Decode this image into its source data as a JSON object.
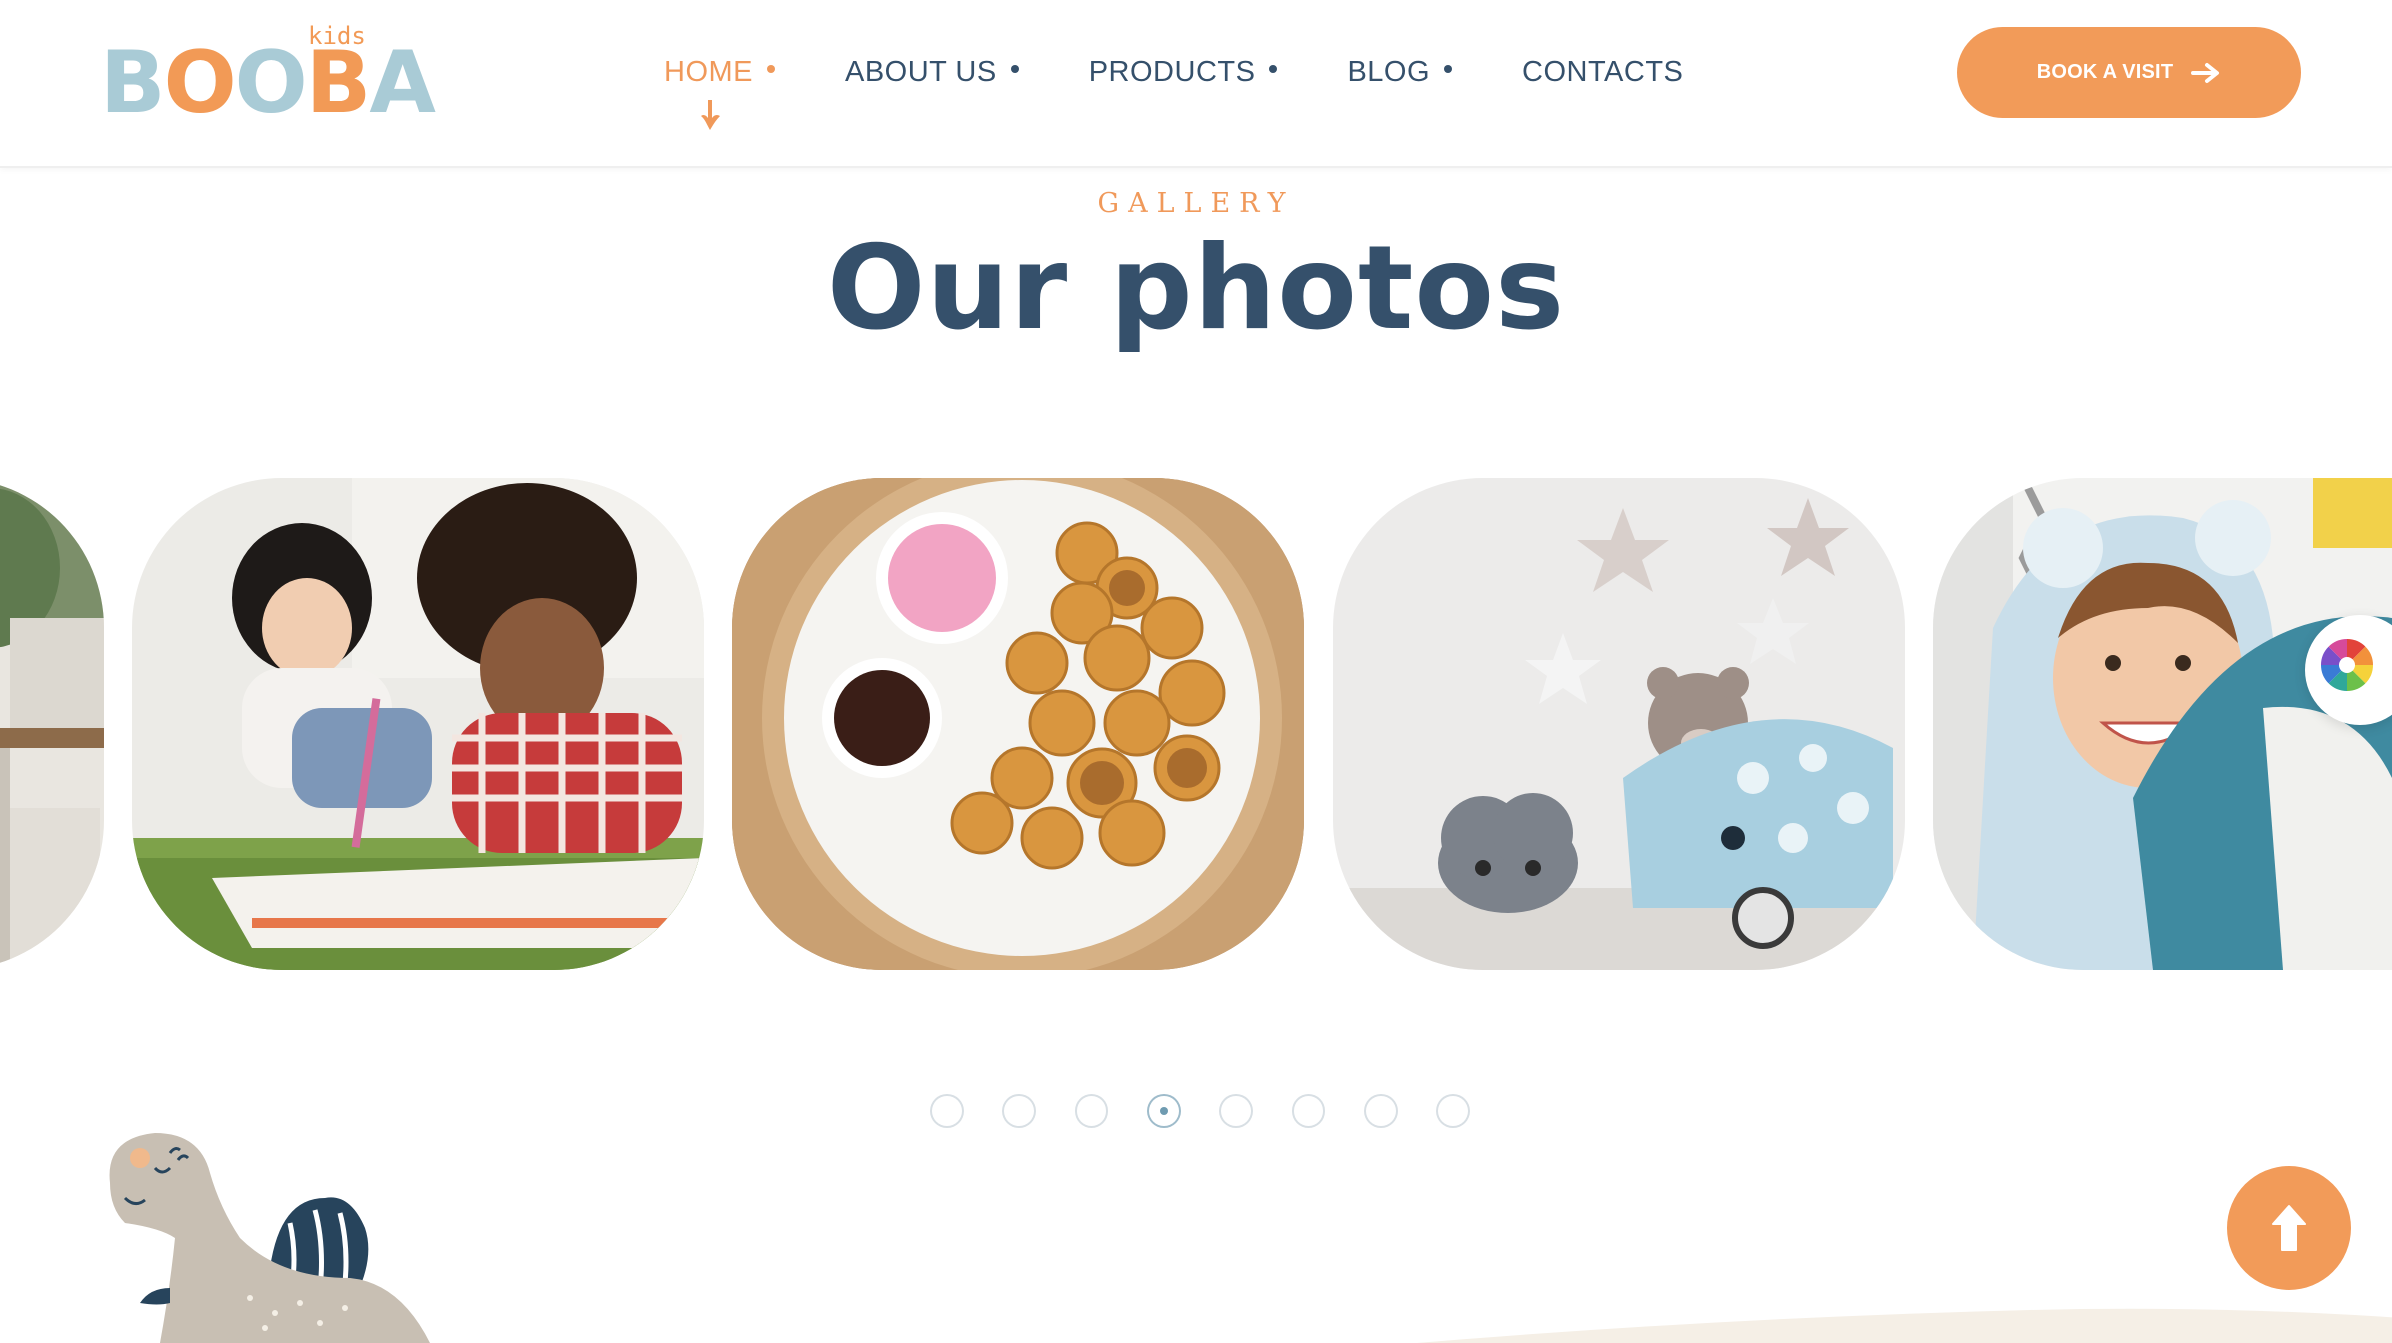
{
  "brand": {
    "logo_word": [
      "B",
      "O",
      "O",
      "B",
      "A"
    ],
    "logo_small": "kids"
  },
  "nav": {
    "items": [
      {
        "label": "HOME",
        "active": true
      },
      {
        "label": "ABOUT US",
        "active": false
      },
      {
        "label": "PRODUCTS",
        "active": false
      },
      {
        "label": "BLOG",
        "active": false
      },
      {
        "label": "CONTACTS",
        "active": false
      }
    ]
  },
  "header": {
    "cta_label": "BOOK A VISIT"
  },
  "gallery": {
    "eyebrow": "GALLERY",
    "title": "Our photos",
    "slides": [
      {
        "subject": "partial room photo"
      },
      {
        "subject": "children drawing on floor"
      },
      {
        "subject": "plate of mini pancakes with dips"
      },
      {
        "subject": "toy cart with teddy bear"
      },
      {
        "subject": "smiling child in bear hoodie with shark plush"
      }
    ],
    "pagination": {
      "total": 8,
      "active_index": 3
    }
  },
  "colors": {
    "accent": "#f29b59",
    "heading": "#35506b",
    "logo_blue": "#a9cbd6"
  },
  "icons": {
    "cta": "arrow-right-icon",
    "scroll": "arrow-up-icon",
    "picker": "color-wheel-icon",
    "nav_active": "hand-pointer-icon"
  }
}
